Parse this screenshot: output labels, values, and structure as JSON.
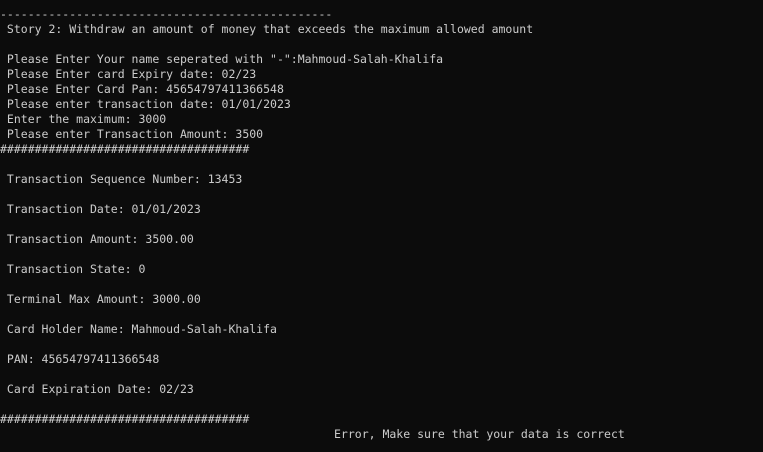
{
  "terminal": {
    "top_divider": "------------------------------------------------",
    "story_title": " Story 2: Withdraw an amount of money that exceeds the maximum allowed amount",
    "prompts": [
      " Please Enter Your name seperated with \"-\":Mahmoud-Salah-Khalifa",
      " Please Enter card Expiry date: 02/23",
      " Please Enter Card Pan: 45654797411366548",
      " Please enter transaction date: 01/01/2023",
      " Enter the maximum: 3000",
      " Please enter Transaction Amount: 3500"
    ],
    "hash_divider": "####################################",
    "details": [
      " Transaction Sequence Number: 13453",
      " Transaction Date: 01/01/2023",
      " Transaction Amount: 3500.00",
      " Transaction State: 0",
      " Terminal Max Amount: 3000.00",
      " Card Holder Name: Mahmoud-Salah-Khalifa",
      " PAN: 45654797411366548",
      " Card Expiration Date: 02/23"
    ],
    "bottom_divider": "####################################",
    "error_message": "Error, Make sure that your data is correct"
  }
}
